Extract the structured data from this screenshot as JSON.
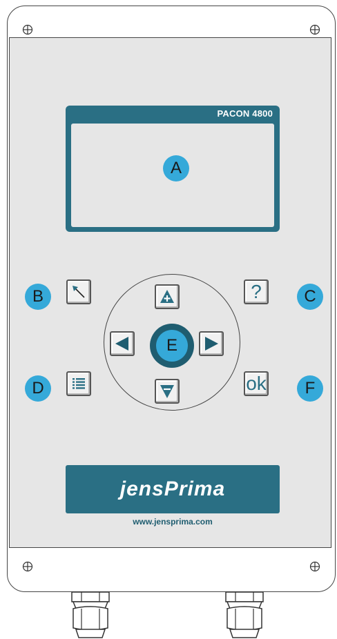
{
  "device": {
    "model": "PACON 4800",
    "brand": "jensPrima",
    "website": "www.jensprima.com"
  },
  "callouts": {
    "a": "A",
    "b": "B",
    "c": "C",
    "d": "D",
    "e": "E",
    "f": "F"
  },
  "keys": {
    "help_label": "?",
    "ok_label": "ok",
    "back_icon": "arrow-up-left-icon",
    "menu_icon": "list-icon",
    "up_icon": "arrow-up-icon",
    "down_icon": "arrow-down-icon",
    "left_icon": "arrow-left-icon",
    "right_icon": "arrow-right-icon"
  },
  "colors": {
    "accent_teal": "#2a6f84",
    "callout_blue": "#35a9d9",
    "faceplate_gray": "#e6e6e6"
  }
}
